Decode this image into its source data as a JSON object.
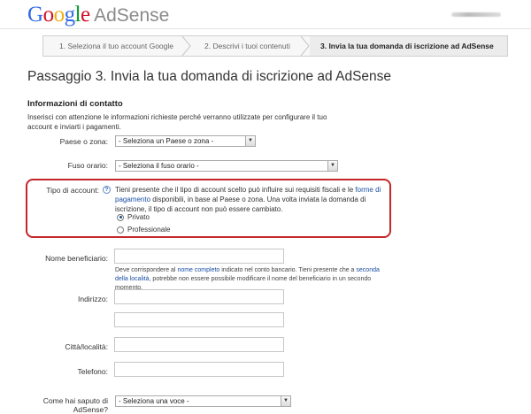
{
  "header": {
    "logo_google": "Google",
    "logo_adsense": "AdSense",
    "google_colors": [
      "#3369e8",
      "#d50f25",
      "#eeb211",
      "#3369e8",
      "#009925",
      "#d50f25"
    ]
  },
  "steps": [
    {
      "label": "1. Seleziona il tuo account Google",
      "active": false
    },
    {
      "label": "2. Descrivi i tuoi contenuti",
      "active": false
    },
    {
      "label": "3. Invia la tua domanda di iscrizione ad AdSense",
      "active": true
    }
  ],
  "page_title": "Passaggio 3. Invia la tua domanda di iscrizione ad AdSense",
  "section_title": "Informazioni di contatto",
  "intro": "Inserisci con attenzione le informazioni richieste perché verranno utilizzate per configurare il tuo account e inviarti i pagamenti.",
  "form": {
    "country": {
      "label": "Paese o zona:",
      "value": "- Seleziona un Paese o zona -"
    },
    "timezone": {
      "label": "Fuso orario:",
      "value": "- Seleziona il fuso orario -"
    },
    "account_type": {
      "label": "Tipo di account:",
      "note_pre": "Tieni presente che il tipo di account scelto può influire sui requisiti fiscali e le ",
      "note_link": "forme di pagamento",
      "note_post": " disponibili, in base al Paese o zona. Una volta inviata la domanda di iscrizione, il tipo di account non può essere cambiato.",
      "options": [
        {
          "label": "Privato",
          "selected": true
        },
        {
          "label": "Professionale",
          "selected": false
        }
      ]
    },
    "payee": {
      "label": "Nome beneficiario:",
      "hint_pre": "Deve corrispondere al ",
      "hint_link1": "nome completo",
      "hint_mid": " indicato nel conto bancario. Tieni presente che a ",
      "hint_link2": "seconda della località",
      "hint_post": ", potrebbe non essere possibile modificare il nome del beneficiario in un secondo momento."
    },
    "address": {
      "label": "Indirizzo:"
    },
    "city": {
      "label": "Città/località:"
    },
    "phone": {
      "label": "Telefono:"
    },
    "referral": {
      "label": "Come hai saputo di AdSense?",
      "value": "- Seleziona una voce -"
    }
  },
  "colors": {
    "accent_red": "#c4262b",
    "link": "#1a4fa3"
  }
}
